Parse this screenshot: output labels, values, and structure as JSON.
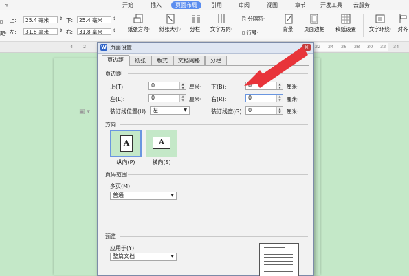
{
  "ribbon": {
    "quick_access_glyph": "▿",
    "tabs": [
      {
        "label": "开始",
        "active": false
      },
      {
        "label": "插入",
        "active": false
      },
      {
        "label": "页面布局",
        "active": true
      },
      {
        "label": "引用",
        "active": false
      },
      {
        "label": "审阅",
        "active": false
      },
      {
        "label": "视图",
        "active": false
      },
      {
        "label": "章节",
        "active": false
      },
      {
        "label": "开发工具",
        "active": false
      },
      {
        "label": "云服务",
        "active": false
      }
    ],
    "margins": {
      "top_label": "上:",
      "top_value": "25.4 毫米",
      "bottom_label": "下:",
      "bottom_value": "25.4 毫米",
      "left_label": "左:",
      "left_value": "31.8 毫米",
      "right_label": "右:",
      "right_value": "31.8 毫米",
      "edge_label_1": "距·"
    },
    "buttons": {
      "orientation": "纸张方向·",
      "size": "纸张大小·",
      "columns": "分栏·",
      "text_direction": "文字方向·",
      "breaks": "分隔符·",
      "line_numbers": "行号·",
      "background": "背景·",
      "page_border": "页面边框",
      "paper_setup": "稿纸设置",
      "wrap": "文字环绕·",
      "align": "对齐"
    }
  },
  "ruler": {
    "ticks": [
      "4",
      "2",
      "2",
      "4",
      "6",
      "8",
      "10",
      "12",
      "14",
      "16",
      "18",
      "20",
      "22",
      "24",
      "26",
      "28",
      "30",
      "32",
      "34"
    ]
  },
  "dialog": {
    "title": "页面设置",
    "app_icon": "W",
    "close": "×",
    "tabs": [
      "页边距",
      "纸张",
      "版式",
      "文档网格",
      "分栏"
    ],
    "margins_group": "页边距",
    "top_label": "上(T):",
    "top_value": "0",
    "top_unit": "厘米·",
    "bottom_label": "下(B):",
    "bottom_value": "0",
    "bottom_unit": "厘米·",
    "left_label": "左(L):",
    "left_value": "0",
    "left_unit": "厘米·",
    "right_label": "右(R):",
    "right_value": "0",
    "right_unit": "厘米·",
    "gutter_pos_label": "装订线位置(U):",
    "gutter_pos_value": "左",
    "gutter_width_label": "装订线宽(G):",
    "gutter_width_value": "0",
    "gutter_width_unit": "厘米·",
    "orientation_group": "方向",
    "portrait_label": "纵向(P)",
    "landscape_label": "横向(S)",
    "orientation_glyph": "A",
    "pages_group": "页码范围",
    "multi_pages_label": "多页(M):",
    "multi_pages_value": "普通",
    "preview_group": "预览",
    "apply_to_label": "应用于(Y):",
    "apply_to_value": "整篇文档"
  },
  "colors": {
    "page_bg": "#c4e8c8",
    "active_tab": "#5b8def",
    "arrow": "#e8343a"
  }
}
